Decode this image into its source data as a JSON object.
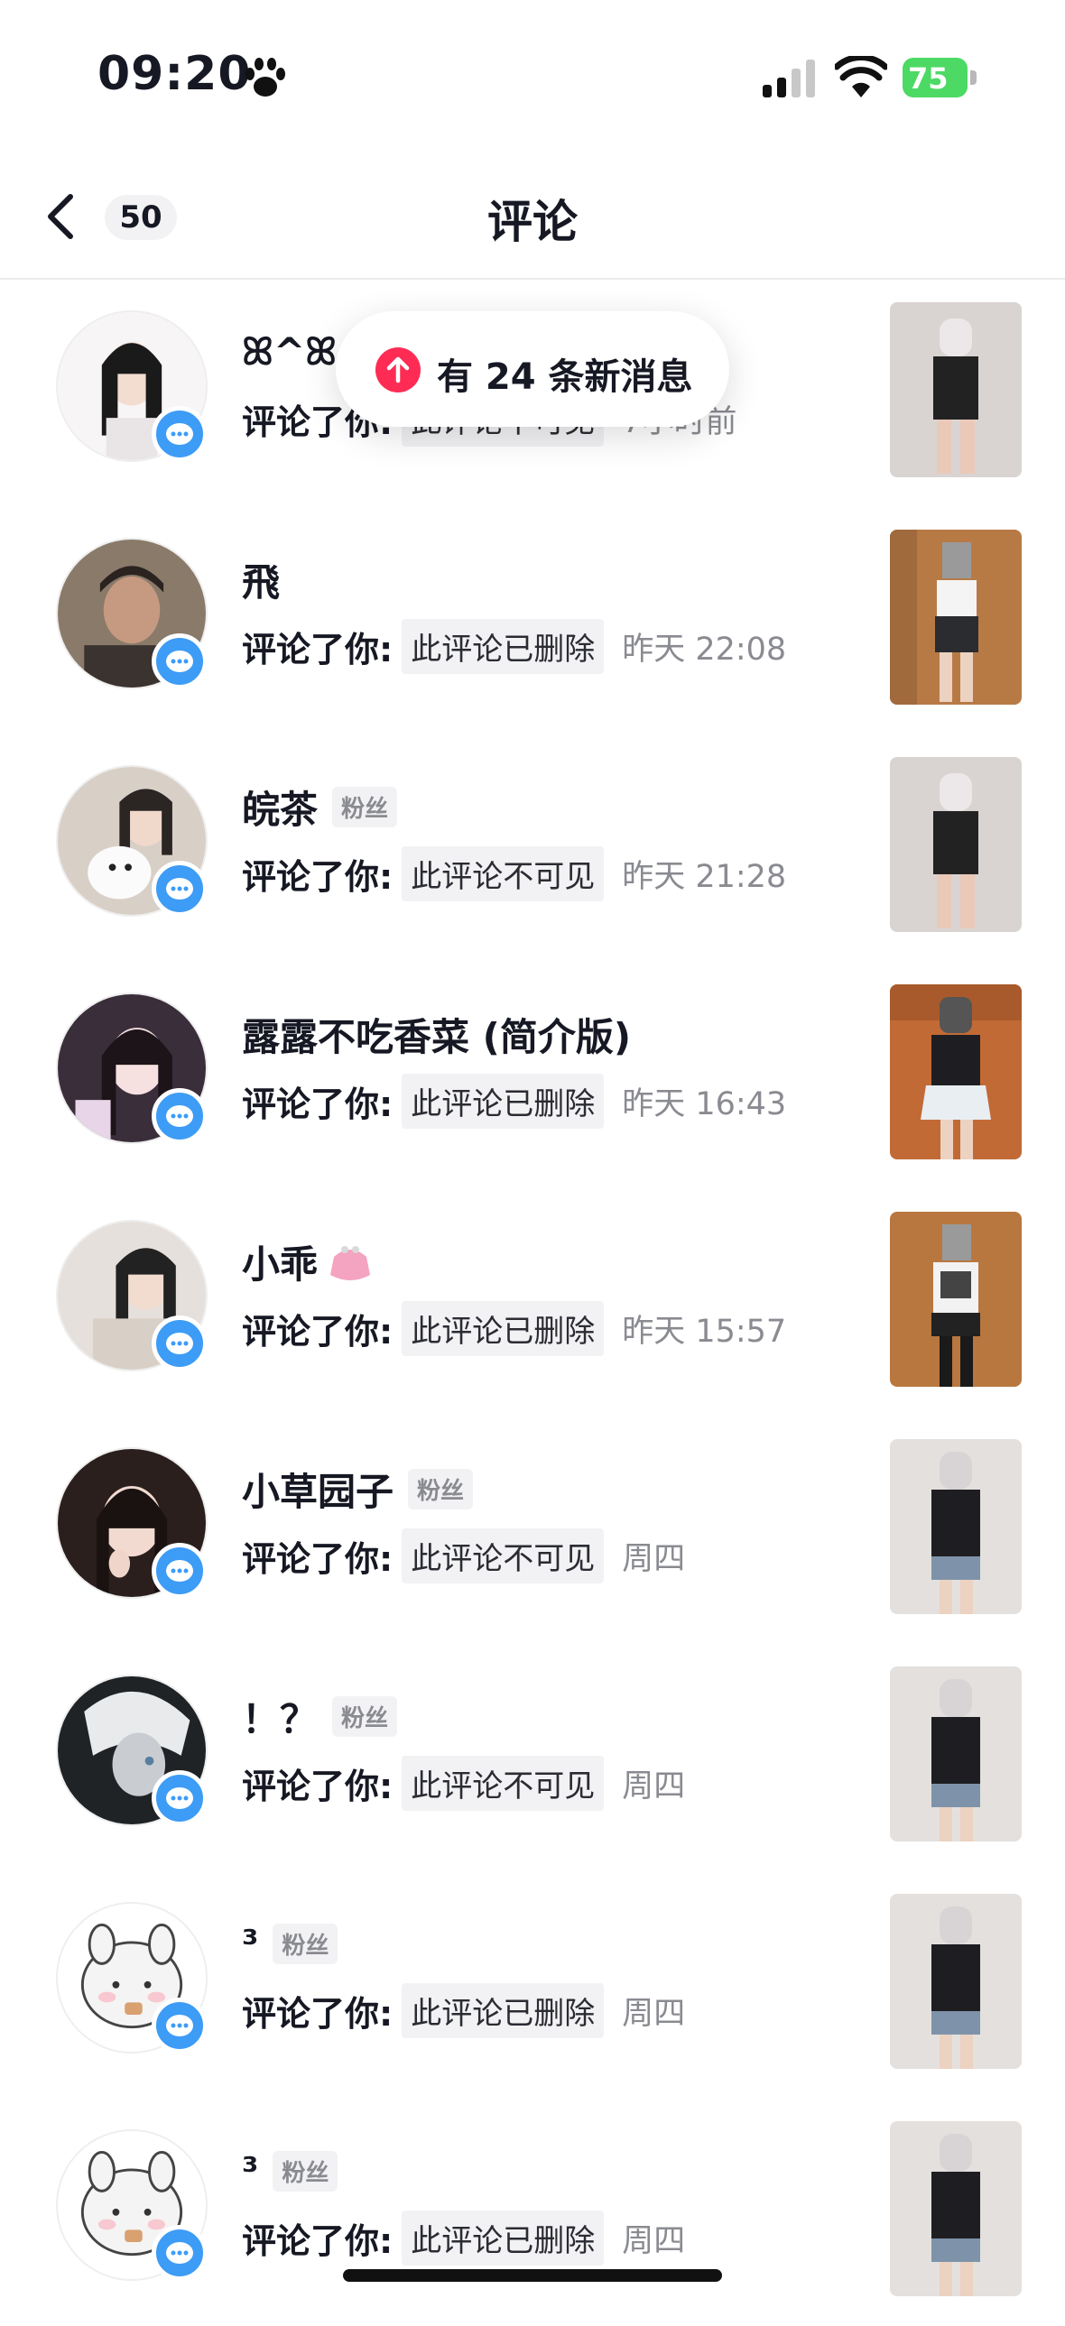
{
  "status_bar": {
    "time": "09:20",
    "battery": "75"
  },
  "nav": {
    "back_count": "50",
    "title": "评论"
  },
  "toast": {
    "text": "有 24 条新消息"
  },
  "comments": [
    {
      "username": "ꕤ^ꕤ",
      "fan_tag": "",
      "action": "评论了你:",
      "quote": "此评论不可见",
      "time": "7小时前"
    },
    {
      "username": "飛",
      "fan_tag": "",
      "action": "评论了你:",
      "quote": "此评论已删除",
      "time": "昨天 22:08"
    },
    {
      "username": "皖茶",
      "fan_tag": "粉丝",
      "action": "评论了你:",
      "quote": "此评论不可见",
      "time": "昨天 21:28"
    },
    {
      "username": "露露不吃香菜 (简介版)",
      "fan_tag": "",
      "action": "评论了你:",
      "quote": "此评论已删除",
      "time": "昨天 16:43"
    },
    {
      "username": "小乖",
      "fan_tag": "",
      "action": "评论了你:",
      "quote": "此评论已删除",
      "time": "昨天 15:57"
    },
    {
      "username": "小草园子",
      "fan_tag": "粉丝",
      "action": "评论了你:",
      "quote": "此评论不可见",
      "time": "周四"
    },
    {
      "username": "！？",
      "fan_tag": "粉丝",
      "action": "评论了你:",
      "quote": "此评论不可见",
      "time": "周四"
    },
    {
      "username": "³",
      "fan_tag": "粉丝",
      "action": "评论了你:",
      "quote": "此评论已删除",
      "time": "周四"
    },
    {
      "username": "³",
      "fan_tag": "粉丝",
      "action": "评论了你:",
      "quote": "此评论已删除",
      "time": "周四"
    }
  ],
  "colors": {
    "accent_blue": "#3d9cf5",
    "toast_red": "#fe2c55",
    "battery_green": "#4cd964",
    "muted_text": "#8a8b91"
  },
  "icons": {
    "back": "chevron-left-icon",
    "comment": "comment-bubble-icon",
    "toast": "arrow-up-icon",
    "status": "paw-icon"
  }
}
